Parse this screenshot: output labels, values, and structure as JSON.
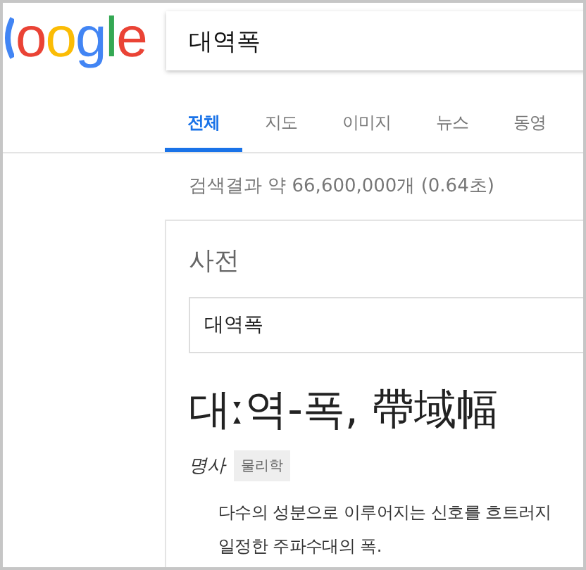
{
  "logo": {
    "text": "oogle"
  },
  "search": {
    "value": "대역폭"
  },
  "tabs": [
    {
      "label": "전체",
      "selected": true
    },
    {
      "label": "지도",
      "selected": false
    },
    {
      "label": "이미지",
      "selected": false
    },
    {
      "label": "뉴스",
      "selected": false
    },
    {
      "label": "동영",
      "selected": false
    }
  ],
  "result_stats": "검색결과 약 66,600,000개 (0.64초)",
  "dictionary": {
    "title": "사전",
    "search_value": "대역폭",
    "headword": "대ː역-폭, 帶域幅",
    "part_of_speech": "명사",
    "tag": "물리학",
    "definition_lines": [
      "다수의 성분으로 이루어지는 신호를 흐트러지",
      "일정한 주파수대의 폭."
    ]
  }
}
